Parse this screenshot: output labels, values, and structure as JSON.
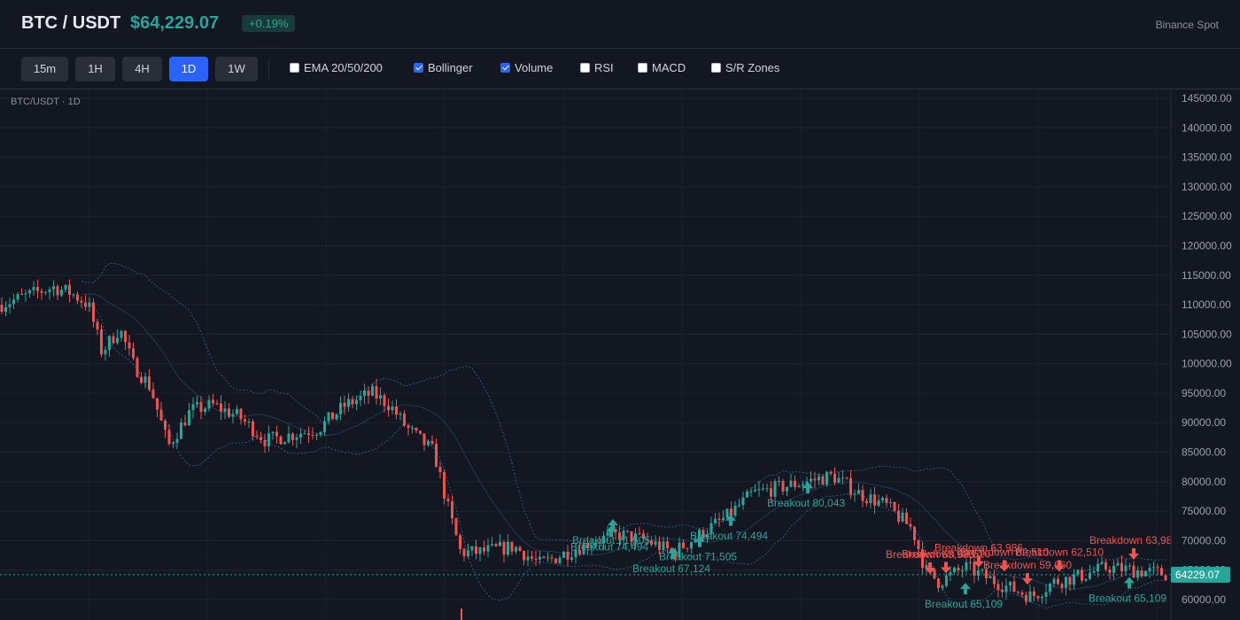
{
  "header": {
    "pair": "BTC / USDT",
    "price": "$64,229.07",
    "change": "+0.19%",
    "exchange": "Binance Spot"
  },
  "toolbar": {
    "timeframes": [
      {
        "label": "15m",
        "active": false
      },
      {
        "label": "1H",
        "active": false
      },
      {
        "label": "4H",
        "active": false
      },
      {
        "label": "1D",
        "active": true
      },
      {
        "label": "1W",
        "active": false
      }
    ],
    "indicators": [
      {
        "label": "EMA 20/50/200",
        "checked": false
      },
      {
        "label": "Bollinger",
        "checked": true
      },
      {
        "label": "Volume",
        "checked": true
      },
      {
        "label": "RSI",
        "checked": false
      },
      {
        "label": "MACD",
        "checked": false
      },
      {
        "label": "S/R Zones",
        "checked": false
      }
    ]
  },
  "chart": {
    "caption": "BTC/USDT · 1D",
    "last_price_label": "64229.07",
    "last_price": 64229.07,
    "y_ticks": [
      "145000.00",
      "140000.00",
      "135000.00",
      "130000.00",
      "125000.00",
      "120000.00",
      "115000.00",
      "110000.00",
      "105000.00",
      "100000.00",
      "95000.00",
      "90000.00",
      "85000.00",
      "80000.00",
      "75000.00",
      "70000.00",
      "65000.00",
      "60000.00"
    ],
    "colors": {
      "up": "#26a69a",
      "down": "#ef5350",
      "band": "#2b5a86",
      "grid": "#1e222d"
    },
    "signals": [
      {
        "type": "breakout",
        "label": "Breakout 74,494",
        "price": 71500
      },
      {
        "type": "breakout",
        "label": "Breakout 71,505",
        "price": 72600
      },
      {
        "type": "breakout",
        "label": "Breakout 67,124",
        "price": 67800
      },
      {
        "type": "breakout",
        "label": "Breakout 71,505",
        "price": 69800
      },
      {
        "type": "breakout",
        "label": "Breakout 74,494",
        "price": 73400
      },
      {
        "type": "breakout",
        "label": "Breakout 80,043",
        "price": 78900
      },
      {
        "type": "breakdown",
        "label": "Breakdown 63,986",
        "price": 65400
      },
      {
        "type": "breakdown",
        "label": "Breakdown 62,510",
        "price": 65500
      },
      {
        "type": "breakdown",
        "label": "Breakdown 63,986",
        "price": 66500
      },
      {
        "type": "breakdown",
        "label": "Breakdown 62,510",
        "price": 65800
      },
      {
        "type": "breakdown",
        "label": "Breakdown 59,660",
        "price": 63600
      },
      {
        "type": "breakdown",
        "label": "Breakdown 62,510",
        "price": 65800
      },
      {
        "type": "breakout",
        "label": "Breakout 65,109",
        "price": 61800
      },
      {
        "type": "breakdown",
        "label": "Breakdown 63,98",
        "price": 67800
      },
      {
        "type": "breakout",
        "label": "Breakout 65,109",
        "price": 62800
      }
    ]
  }
}
